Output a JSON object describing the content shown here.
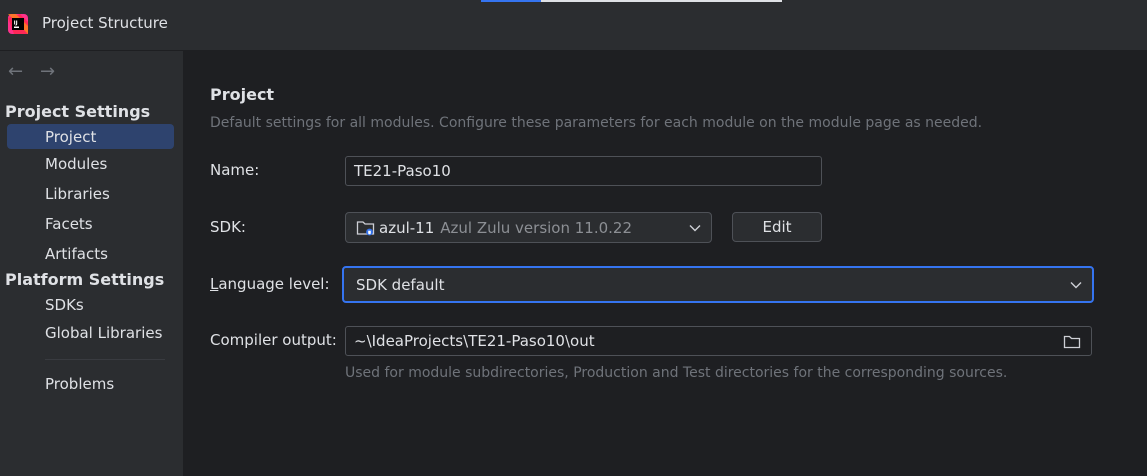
{
  "window": {
    "title": "Project Structure"
  },
  "sidebar": {
    "groups": [
      {
        "header": "Project Settings",
        "items": [
          "Project",
          "Modules",
          "Libraries",
          "Facets",
          "Artifacts"
        ]
      },
      {
        "header": "Platform Settings",
        "items": [
          "SDKs",
          "Global Libraries"
        ]
      }
    ],
    "extra_items": [
      "Problems"
    ],
    "selected": "Project"
  },
  "main": {
    "title": "Project",
    "description": "Default settings for all modules. Configure these parameters for each module on the module page as needed.",
    "name": {
      "label": "Name:",
      "value": "TE21-Paso10"
    },
    "sdk": {
      "label": "SDK:",
      "value": "azul-11",
      "detail": "Azul Zulu version 11.0.22",
      "edit_label": "Edit"
    },
    "language_level": {
      "label_mnemonic": "L",
      "label_rest": "anguage level:",
      "value": "SDK default"
    },
    "compiler_output": {
      "label": "Compiler output:",
      "value": "~\\IdeaProjects\\TE21-Paso10\\out",
      "hint": "Used for module subdirectories, Production and Test directories for the corresponding sources."
    }
  },
  "icons": {
    "app": "intellij-logo-icon",
    "back": "arrow-left-icon",
    "forward": "arrow-right-icon",
    "sdk": "sdk-folder-icon",
    "dropdown": "chevron-down-icon",
    "browse": "folder-icon"
  },
  "colors": {
    "accent": "#3574f0",
    "selection": "#2e436e",
    "background": "#1e1f22",
    "panel": "#2b2d30"
  }
}
